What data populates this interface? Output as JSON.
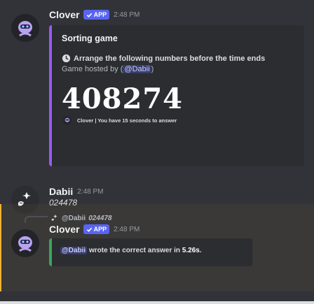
{
  "message1": {
    "username": "Clover",
    "app_tag": "APP",
    "timestamp": "2:48 PM",
    "embed": {
      "color": "#9b59f6",
      "title": "Sorting game",
      "description": "Arrange the following numbers before the time ends",
      "hosted_prefix": "Game hosted by (",
      "hosted_mention": "@Dabii",
      "hosted_suffix": ")",
      "number": "408274",
      "footer": "Clover | You have 15 seconds to answer"
    }
  },
  "message2": {
    "username": "Dabii",
    "timestamp": "2:48 PM",
    "content": "024478"
  },
  "message3": {
    "reply": {
      "author": "@Dabii",
      "content": "024478"
    },
    "username": "Clover",
    "app_tag": "APP",
    "timestamp": "2:48 PM",
    "embed": {
      "color": "#3ba55d",
      "mention": "@Dabii",
      "text": " wrote the correct answer in ",
      "time": "5.26s",
      "end": "."
    }
  },
  "colors": {
    "background": "#313338",
    "embed_bg": "#2b2d31",
    "blurple": "#5865f2",
    "mention_highlight": "#f0b232"
  },
  "icons": [
    "clover-bot-avatar",
    "dabii-avatar",
    "verified-check-icon",
    "clock-icon",
    "reply-avatar-icon"
  ]
}
